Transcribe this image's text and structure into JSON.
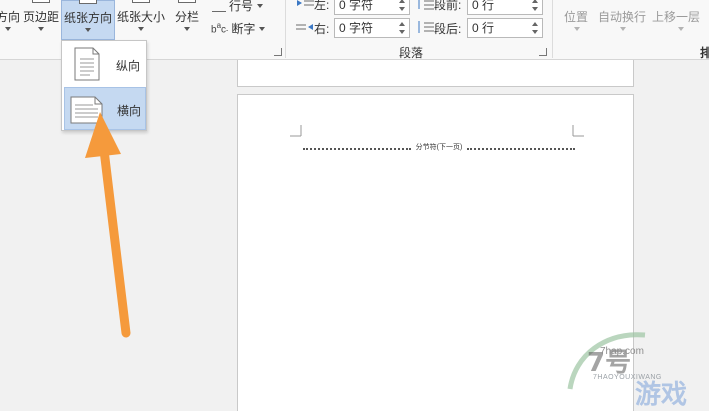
{
  "ribbon": {
    "orientation_partial": "方向",
    "margins": "页边距",
    "paper_orientation": "纸张方向",
    "paper_size": "纸张大小",
    "columns": "分栏",
    "line_numbers": "行号",
    "hyphenation": "断字",
    "paragraph": {
      "indent_left_label": "左:",
      "indent_left_value": "0 字符",
      "indent_right_label": "右:",
      "indent_right_value": "0 字符",
      "space_before_label": "段前:",
      "space_before_value": "0 行",
      "space_after_label": "段后:",
      "space_after_value": "0 行",
      "group_name": "段落"
    },
    "arrange": {
      "position": "位置",
      "wrap_text": "自动换行",
      "bring_forward": "上移一层",
      "group_partial": "排"
    }
  },
  "orientation_menu": {
    "items": [
      {
        "label": "纵向",
        "selected": false
      },
      {
        "label": "横向",
        "selected": true
      }
    ]
  },
  "document": {
    "section_break": "分节符(下一页)"
  },
  "watermark": {
    "url": "7hap.com",
    "sub": "7HAOYOUXIWANG",
    "name": "游戏"
  },
  "colors": {
    "accent_selected": "#c5d9f1",
    "annotation_arrow": "#f59a3c"
  }
}
